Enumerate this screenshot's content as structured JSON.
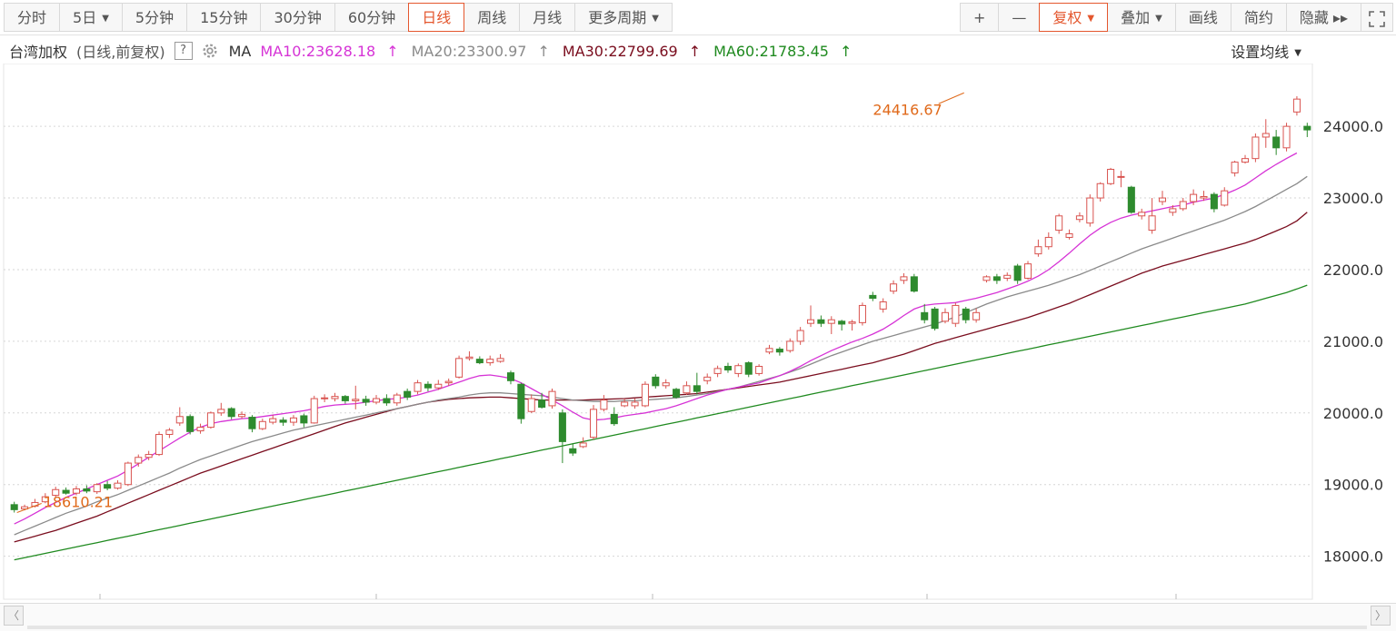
{
  "toolbar": {
    "left": [
      {
        "label": "分时",
        "active": false,
        "caret": false
      },
      {
        "label": "5日",
        "active": false,
        "caret": true
      },
      {
        "label": "5分钟",
        "active": false,
        "caret": false
      },
      {
        "label": "15分钟",
        "active": false,
        "caret": false
      },
      {
        "label": "30分钟",
        "active": false,
        "caret": false
      },
      {
        "label": "60分钟",
        "active": false,
        "caret": false
      },
      {
        "label": "日线",
        "active": true,
        "caret": false
      },
      {
        "label": "周线",
        "active": false,
        "caret": false
      },
      {
        "label": "月线",
        "active": false,
        "caret": false
      },
      {
        "label": "更多周期",
        "active": false,
        "caret": true
      }
    ],
    "right": [
      {
        "label": "+",
        "red": false,
        "caret": false
      },
      {
        "label": "—",
        "red": false,
        "caret": false
      },
      {
        "label": "复权",
        "red": true,
        "caret": true
      },
      {
        "label": "叠加",
        "red": false,
        "caret": true
      },
      {
        "label": "画线",
        "red": false,
        "caret": false
      },
      {
        "label": "简约",
        "red": false,
        "caret": false
      },
      {
        "label": "隐藏 ▸▸",
        "red": false,
        "caret": false
      }
    ],
    "fullscreen_icon": "fullscreen-icon"
  },
  "legend": {
    "name": "台湾加权",
    "mode": "(日线,前复权)",
    "help": "?",
    "ma_label": "MA",
    "ma": [
      {
        "text": "MA10:23628.18",
        "color": "#d633d6"
      },
      {
        "text": "MA20:23300.97",
        "color": "#8a8a8a"
      },
      {
        "text": "MA30:22799.69",
        "color": "#7a0d1e"
      },
      {
        "text": "MA60:21783.45",
        "color": "#1f8a1f"
      }
    ],
    "arrow": "↑",
    "setting": "设置均线"
  },
  "colors": {
    "up": "#d9534f",
    "down": "#2e8b2e",
    "grid": "#d6d6d6",
    "axis_text": "#333333",
    "annotation": "#e06a1b"
  },
  "chart_data": {
    "type": "candlestick",
    "ylim": [
      17400,
      24800
    ],
    "yticks": [
      18000,
      19000,
      20000,
      21000,
      22000,
      23000,
      24000
    ],
    "ytick_labels": [
      "18000.0",
      "19000.0",
      "20000.0",
      "21000.0",
      "22000.0",
      "23000.0",
      "24000.0"
    ],
    "annotations": [
      {
        "label": "18610.21",
        "index": 0,
        "value": 18610.21
      },
      {
        "label": "24416.67",
        "index": 92,
        "value": 24416.67
      }
    ],
    "candles": [
      [
        18720,
        18650,
        18760,
        18610
      ],
      [
        18660,
        18690,
        18720,
        18640
      ],
      [
        18700,
        18750,
        18800,
        18680
      ],
      [
        18760,
        18830,
        18880,
        18740
      ],
      [
        18850,
        18930,
        18970,
        18820
      ],
      [
        18920,
        18880,
        18960,
        18860
      ],
      [
        18880,
        18940,
        18980,
        18850
      ],
      [
        18940,
        18910,
        18990,
        18880
      ],
      [
        18900,
        19000,
        19020,
        18870
      ],
      [
        19000,
        18950,
        19050,
        18920
      ],
      [
        18950,
        19020,
        19060,
        18930
      ],
      [
        19000,
        19300,
        19320,
        18980
      ],
      [
        19300,
        19380,
        19420,
        19250
      ],
      [
        19380,
        19420,
        19470,
        19340
      ],
      [
        19420,
        19700,
        19740,
        19400
      ],
      [
        19700,
        19760,
        19790,
        19650
      ],
      [
        19860,
        19950,
        20080,
        19820
      ],
      [
        19950,
        19740,
        19980,
        19700
      ],
      [
        19750,
        19800,
        19850,
        19710
      ],
      [
        19800,
        20000,
        20020,
        19780
      ],
      [
        20000,
        20050,
        20140,
        19960
      ],
      [
        20060,
        19950,
        20080,
        19910
      ],
      [
        19950,
        19980,
        20020,
        19920
      ],
      [
        19940,
        19780,
        19970,
        19730
      ],
      [
        19780,
        19880,
        19920,
        19760
      ],
      [
        19870,
        19920,
        19970,
        19840
      ],
      [
        19900,
        19870,
        19940,
        19820
      ],
      [
        19870,
        19930,
        19970,
        19820
      ],
      [
        19960,
        19860,
        19990,
        19800
      ],
      [
        19860,
        20200,
        20240,
        19850
      ],
      [
        20200,
        20210,
        20260,
        20150
      ],
      [
        20200,
        20230,
        20280,
        20160
      ],
      [
        20230,
        20170,
        20250,
        20130
      ],
      [
        20170,
        20190,
        20380,
        20050
      ],
      [
        20190,
        20150,
        20240,
        20100
      ],
      [
        20150,
        20200,
        20250,
        20120
      ],
      [
        20200,
        20140,
        20260,
        20100
      ],
      [
        20140,
        20250,
        20280,
        20100
      ],
      [
        20300,
        20220,
        20340,
        20180
      ],
      [
        20300,
        20420,
        20460,
        20260
      ],
      [
        20400,
        20350,
        20440,
        20300
      ],
      [
        20350,
        20400,
        20460,
        20320
      ],
      [
        20420,
        20440,
        20480,
        20380
      ],
      [
        20500,
        20760,
        20800,
        20480
      ],
      [
        20760,
        20780,
        20860,
        20730
      ],
      [
        20750,
        20700,
        20790,
        20680
      ],
      [
        20700,
        20750,
        20800,
        20660
      ],
      [
        20720,
        20760,
        20820,
        20700
      ],
      [
        20560,
        20450,
        20590,
        20400
      ],
      [
        20400,
        19920,
        20420,
        19850
      ],
      [
        20020,
        20200,
        20260,
        20000
      ],
      [
        20180,
        20080,
        20280,
        20060
      ],
      [
        20100,
        20300,
        20340,
        20060
      ],
      [
        20000,
        19600,
        20050,
        19300
      ],
      [
        19500,
        19440,
        19580,
        19400
      ],
      [
        19530,
        19580,
        19660,
        19510
      ],
      [
        19660,
        20050,
        20110,
        19630
      ],
      [
        20050,
        20180,
        20250,
        20020
      ],
      [
        19980,
        19850,
        20080,
        19820
      ],
      [
        20100,
        20150,
        20200,
        20080
      ],
      [
        20100,
        20150,
        20200,
        20060
      ],
      [
        20100,
        20400,
        20440,
        20080
      ],
      [
        20500,
        20380,
        20540,
        20340
      ],
      [
        20380,
        20420,
        20470,
        20340
      ],
      [
        20330,
        20220,
        20350,
        20200
      ],
      [
        20280,
        20380,
        20440,
        20250
      ],
      [
        20380,
        20300,
        20560,
        20260
      ],
      [
        20450,
        20500,
        20550,
        20400
      ],
      [
        20550,
        20620,
        20660,
        20500
      ],
      [
        20650,
        20600,
        20700,
        20560
      ],
      [
        20550,
        20660,
        20690,
        20500
      ],
      [
        20700,
        20540,
        20720,
        20500
      ],
      [
        20550,
        20650,
        20680,
        20520
      ],
      [
        20850,
        20900,
        20950,
        20820
      ],
      [
        20890,
        20850,
        20920,
        20800
      ],
      [
        20870,
        21000,
        21040,
        20840
      ],
      [
        21000,
        21150,
        21200,
        20950
      ],
      [
        21250,
        21300,
        21500,
        21200
      ],
      [
        21300,
        21250,
        21360,
        21200
      ],
      [
        21250,
        21300,
        21350,
        21100
      ],
      [
        21280,
        21240,
        21300,
        21150
      ],
      [
        21250,
        21270,
        21300,
        21150
      ],
      [
        21260,
        21500,
        21540,
        21220
      ],
      [
        21640,
        21600,
        21690,
        21560
      ],
      [
        21450,
        21550,
        21600,
        21400
      ],
      [
        21700,
        21800,
        21850,
        21660
      ],
      [
        21850,
        21900,
        21950,
        21800
      ],
      [
        21900,
        21700,
        21940,
        21680
      ],
      [
        21400,
        21300,
        21520,
        21250
      ],
      [
        21450,
        21180,
        21480,
        21150
      ],
      [
        21280,
        21400,
        21460,
        21250
      ],
      [
        21250,
        21500,
        21540,
        21200
      ],
      [
        21450,
        21300,
        21480,
        21250
      ],
      [
        21300,
        21400,
        21460,
        21260
      ],
      [
        21850,
        21900,
        21920,
        21820
      ],
      [
        21900,
        21850,
        21940,
        21800
      ],
      [
        21880,
        21920,
        21960,
        21840
      ],
      [
        22050,
        21850,
        22080,
        21800
      ],
      [
        21880,
        22080,
        22120,
        21860
      ],
      [
        22220,
        22320,
        22420,
        22180
      ],
      [
        22320,
        22450,
        22520,
        22280
      ],
      [
        22550,
        22750,
        22780,
        22500
      ],
      [
        22450,
        22500,
        22560,
        22420
      ],
      [
        22700,
        22750,
        22800,
        22660
      ],
      [
        22650,
        23000,
        23050,
        22600
      ],
      [
        23000,
        23200,
        23220,
        22950
      ],
      [
        23200,
        23400,
        23420,
        23180
      ],
      [
        23300,
        23300,
        23380,
        23150
      ],
      [
        23150,
        22800,
        23170,
        22780
      ],
      [
        22750,
        22800,
        22850,
        22700
      ],
      [
        22550,
        22750,
        23000,
        22500
      ],
      [
        22950,
        23000,
        23100,
        22900
      ],
      [
        22800,
        22850,
        22900,
        22750
      ],
      [
        22850,
        22950,
        23000,
        22820
      ],
      [
        22950,
        23050,
        23120,
        22900
      ],
      [
        23000,
        23020,
        23100,
        22960
      ],
      [
        23050,
        22850,
        23080,
        22800
      ],
      [
        22900,
        23100,
        23150,
        22880
      ],
      [
        23350,
        23500,
        23520,
        23300
      ],
      [
        23500,
        23550,
        23600,
        23480
      ],
      [
        23550,
        23850,
        23900,
        23500
      ],
      [
        23850,
        23900,
        24100,
        23700
      ],
      [
        23850,
        23700,
        23950,
        23600
      ],
      [
        23700,
        24000,
        24050,
        23650
      ],
      [
        24200,
        24380,
        24420,
        24150
      ],
      [
        24000,
        23950,
        24050,
        23850
      ]
    ],
    "ma10": [
      18450,
      18520,
      18600,
      18680,
      18750,
      18820,
      18880,
      18940,
      19000,
      19060,
      19120,
      19200,
      19290,
      19380,
      19470,
      19560,
      19650,
      19730,
      19800,
      19850,
      19880,
      19900,
      19920,
      19930,
      19950,
      19970,
      19990,
      20010,
      20030,
      20060,
      20090,
      20110,
      20120,
      20130,
      20150,
      20170,
      20190,
      20200,
      20220,
      20250,
      20290,
      20330,
      20380,
      20430,
      20480,
      20520,
      20530,
      20510,
      20480,
      20420,
      20340,
      20260,
      20180,
      20100,
      20010,
      19930,
      19900,
      19910,
      19930,
      19960,
      19980,
      20000,
      20030,
      20060,
      20100,
      20150,
      20200,
      20250,
      20290,
      20330,
      20360,
      20390,
      20420,
      20470,
      20520,
      20580,
      20650,
      20730,
      20800,
      20870,
      20930,
      20990,
      21040,
      21100,
      21170,
      21260,
      21360,
      21450,
      21500,
      21520,
      21530,
      21540,
      21570,
      21600,
      21640,
      21680,
      21730,
      21780,
      21840,
      21910,
      22000,
      22110,
      22230,
      22360,
      22480,
      22580,
      22660,
      22720,
      22760,
      22790,
      22820,
      22850,
      22880,
      22900,
      22940,
      22970,
      23000,
      23050,
      23110,
      23180,
      23280,
      23380,
      23470,
      23550,
      23628
    ],
    "ma20": [
      18300,
      18360,
      18420,
      18480,
      18540,
      18600,
      18650,
      18700,
      18760,
      18810,
      18860,
      18920,
      18980,
      19040,
      19100,
      19160,
      19230,
      19290,
      19350,
      19400,
      19450,
      19500,
      19550,
      19600,
      19640,
      19680,
      19720,
      19760,
      19790,
      19820,
      19850,
      19880,
      19910,
      19940,
      19970,
      20000,
      20030,
      20060,
      20090,
      20120,
      20150,
      20180,
      20200,
      20220,
      20250,
      20270,
      20280,
      20280,
      20270,
      20260,
      20250,
      20240,
      20220,
      20200,
      20180,
      20170,
      20160,
      20160,
      20160,
      20170,
      20170,
      20180,
      20190,
      20200,
      20210,
      20230,
      20250,
      20270,
      20300,
      20330,
      20360,
      20400,
      20440,
      20480,
      20520,
      20570,
      20620,
      20680,
      20740,
      20800,
      20850,
      20900,
      20950,
      21000,
      21040,
      21080,
      21120,
      21160,
      21200,
      21240,
      21290,
      21340,
      21400,
      21460,
      21520,
      21570,
      21620,
      21660,
      21700,
      21740,
      21780,
      21830,
      21880,
      21930,
      21990,
      22050,
      22110,
      22170,
      22230,
      22290,
      22340,
      22390,
      22440,
      22490,
      22540,
      22590,
      22640,
      22690,
      22750,
      22810,
      22880,
      22960,
      23040,
      23120,
      23200,
      23301
    ],
    "ma30": [
      18200,
      18240,
      18280,
      18320,
      18360,
      18410,
      18460,
      18510,
      18560,
      18620,
      18680,
      18740,
      18800,
      18860,
      18920,
      18980,
      19040,
      19100,
      19160,
      19210,
      19260,
      19310,
      19360,
      19410,
      19460,
      19510,
      19560,
      19610,
      19660,
      19710,
      19760,
      19810,
      19860,
      19900,
      19940,
      19980,
      20020,
      20060,
      20090,
      20120,
      20150,
      20170,
      20190,
      20200,
      20210,
      20215,
      20220,
      20220,
      20210,
      20200,
      20190,
      20180,
      20180,
      20180,
      20180,
      20180,
      20185,
      20190,
      20195,
      20200,
      20210,
      20220,
      20230,
      20240,
      20250,
      20260,
      20270,
      20290,
      20310,
      20330,
      20350,
      20370,
      20390,
      20410,
      20430,
      20460,
      20490,
      20520,
      20550,
      20580,
      20610,
      20640,
      20670,
      20700,
      20740,
      20780,
      20820,
      20870,
      20920,
      20970,
      21010,
      21050,
      21090,
      21130,
      21170,
      21210,
      21250,
      21290,
      21330,
      21380,
      21430,
      21480,
      21530,
      21590,
      21650,
      21710,
      21770,
      21830,
      21890,
      21950,
      22000,
      22050,
      22090,
      22130,
      22170,
      22210,
      22250,
      22290,
      22330,
      22370,
      22420,
      22480,
      22540,
      22600,
      22680,
      22800
    ],
    "ma60": [
      17950,
      17980,
      18010,
      18040,
      18070,
      18100,
      18130,
      18160,
      18190,
      18220,
      18250,
      18280,
      18310,
      18340,
      18370,
      18400,
      18430,
      18460,
      18490,
      18520,
      18550,
      18580,
      18610,
      18640,
      18670,
      18700,
      18730,
      18760,
      18790,
      18820,
      18850,
      18880,
      18910,
      18940,
      18970,
      19000,
      19030,
      19060,
      19090,
      19120,
      19150,
      19180,
      19210,
      19240,
      19270,
      19300,
      19330,
      19360,
      19390,
      19420,
      19450,
      19480,
      19510,
      19540,
      19570,
      19600,
      19630,
      19660,
      19690,
      19720,
      19750,
      19780,
      19810,
      19840,
      19870,
      19900,
      19930,
      19960,
      19990,
      20020,
      20050,
      20080,
      20110,
      20140,
      20170,
      20200,
      20230,
      20260,
      20290,
      20320,
      20350,
      20380,
      20410,
      20440,
      20470,
      20500,
      20530,
      20560,
      20590,
      20620,
      20650,
      20680,
      20710,
      20740,
      20770,
      20800,
      20830,
      20860,
      20890,
      20920,
      20950,
      20980,
      21010,
      21040,
      21070,
      21100,
      21130,
      21160,
      21190,
      21220,
      21250,
      21280,
      21310,
      21340,
      21370,
      21400,
      21430,
      21460,
      21490,
      21520,
      21560,
      21600,
      21640,
      21680,
      21730,
      21783
    ]
  }
}
